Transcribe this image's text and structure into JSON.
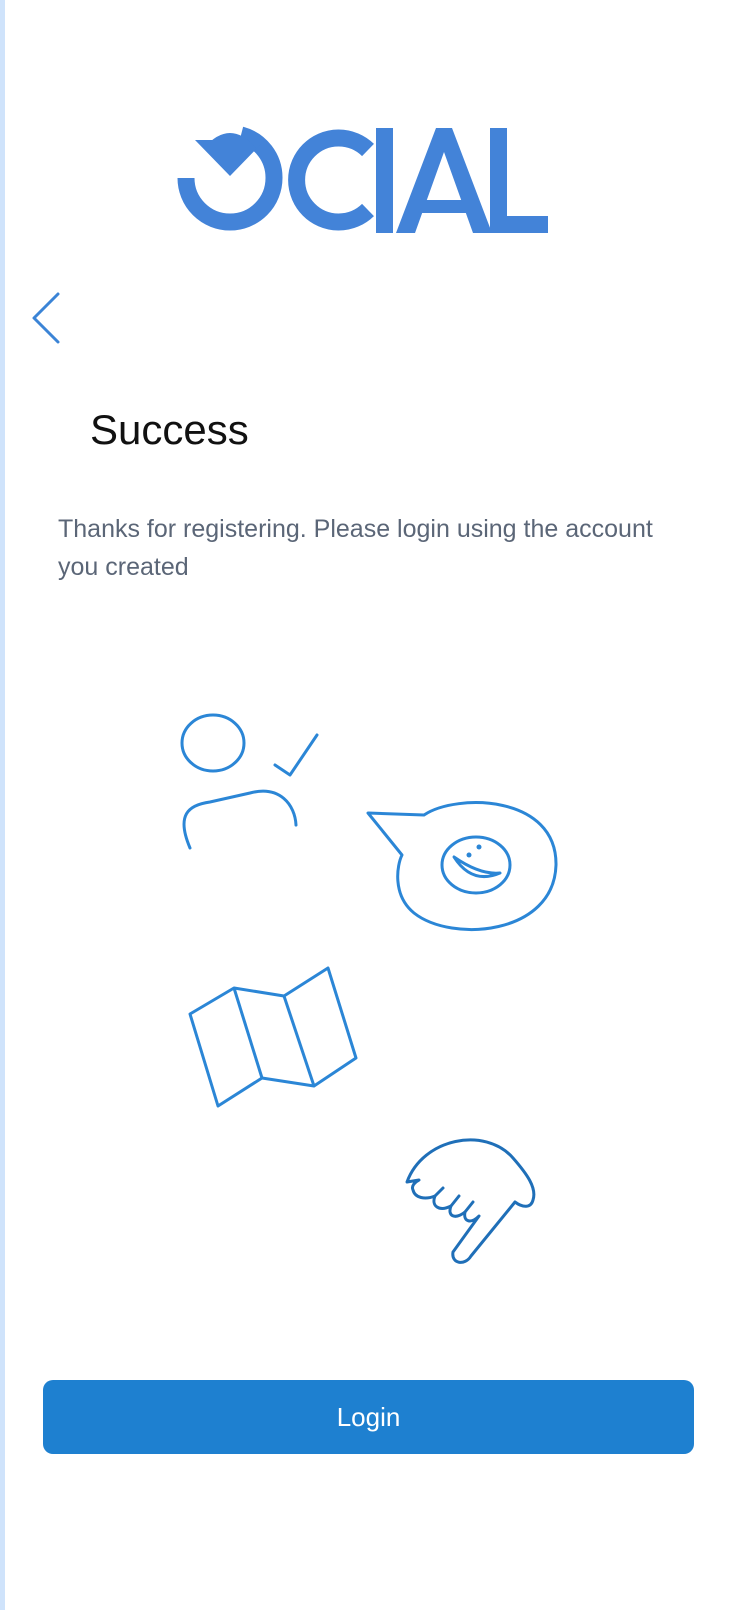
{
  "brand": {
    "logo_text": "OCIAL",
    "color": "#4383d8"
  },
  "nav": {
    "back_icon": "chevron-left-icon"
  },
  "content": {
    "title": "Success",
    "message": "Thanks for registering. Please login using the account you created"
  },
  "illustrations": [
    "user-check-icon",
    "chat-bubble-smile-icon",
    "map-icon",
    "pointing-hand-icon"
  ],
  "actions": {
    "login_label": "Login"
  },
  "colors": {
    "accent": "#1e80d0",
    "illustration": "#2b86d6",
    "side_strip": "#cfe3fb"
  }
}
